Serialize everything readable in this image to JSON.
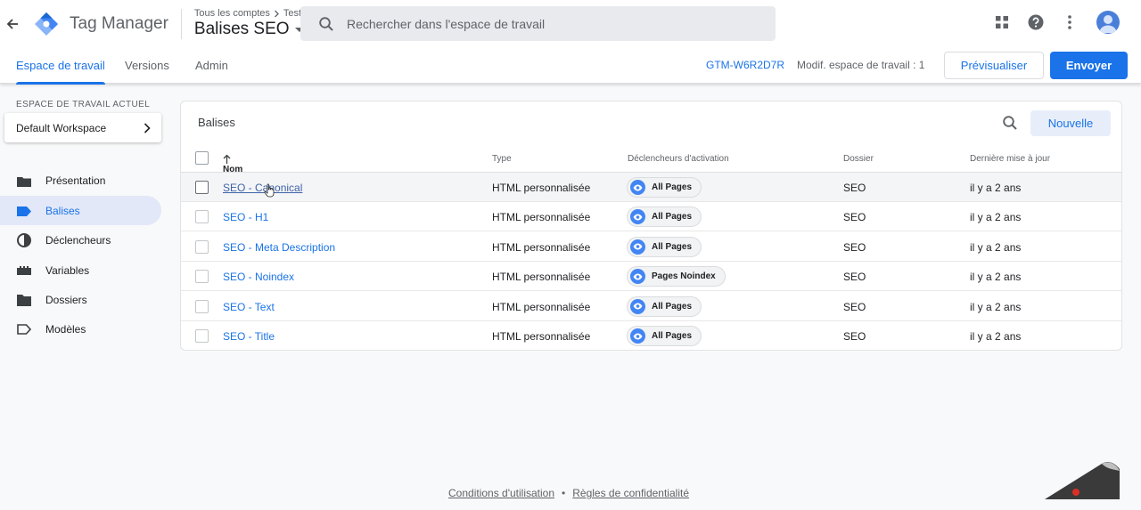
{
  "header": {
    "app_title": "Tag Manager",
    "breadcrumb": {
      "account": "Tous les comptes",
      "container": "Test"
    },
    "container_name": "Balises SEO",
    "search_placeholder": "Rechercher dans l'espace de travail"
  },
  "subnav": {
    "tabs": [
      "Espace de travail",
      "Versions",
      "Admin"
    ],
    "active_tab": "Espace de travail",
    "container_id": "GTM-W6R2D7R",
    "workspace_changes": "Modif. espace de travail : 1",
    "preview_label": "Prévisualiser",
    "send_label": "Envoyer"
  },
  "sidebar": {
    "workspace_label": "ESPACE DE TRAVAIL ACTUEL",
    "workspace_name": "Default Workspace",
    "items": [
      {
        "label": "Présentation",
        "icon": "folder-tab-icon"
      },
      {
        "label": "Balises",
        "icon": "tag-icon",
        "active": true
      },
      {
        "label": "Déclencheurs",
        "icon": "trigger-icon"
      },
      {
        "label": "Variables",
        "icon": "variables-icon"
      },
      {
        "label": "Dossiers",
        "icon": "folder-icon"
      },
      {
        "label": "Modèles",
        "icon": "template-icon"
      }
    ]
  },
  "tags_card": {
    "title": "Balises",
    "new_label": "Nouvelle",
    "columns": [
      "Nom",
      "Type",
      "Déclencheurs d'activation",
      "Dossier",
      "Dernière mise à jour"
    ],
    "rows": [
      {
        "name": "SEO - Canonical",
        "type": "HTML personnalisée",
        "trigger": "All Pages",
        "folder": "SEO",
        "updated": "il y a 2 ans"
      },
      {
        "name": "SEO - H1",
        "type": "HTML personnalisée",
        "trigger": "All Pages",
        "folder": "SEO",
        "updated": "il y a 2 ans"
      },
      {
        "name": "SEO - Meta Description",
        "type": "HTML personnalisée",
        "trigger": "All Pages",
        "folder": "SEO",
        "updated": "il y a 2 ans"
      },
      {
        "name": "SEO - Noindex",
        "type": "HTML personnalisée",
        "trigger": "Pages Noindex",
        "folder": "SEO",
        "updated": "il y a 2 ans"
      },
      {
        "name": "SEO - Text",
        "type": "HTML personnalisée",
        "trigger": "All Pages",
        "folder": "SEO",
        "updated": "il y a 2 ans"
      },
      {
        "name": "SEO - Title",
        "type": "HTML personnalisée",
        "trigger": "All Pages",
        "folder": "SEO",
        "updated": "il y a 2 ans"
      }
    ]
  },
  "footer": {
    "terms": "Conditions d'utilisation",
    "separator": "•",
    "privacy": "Règles de confidentialité"
  },
  "colors": {
    "accent": "#1a73e8",
    "logo_blue": "#4285f4",
    "active_nav_bg": "#e2e8f8"
  }
}
